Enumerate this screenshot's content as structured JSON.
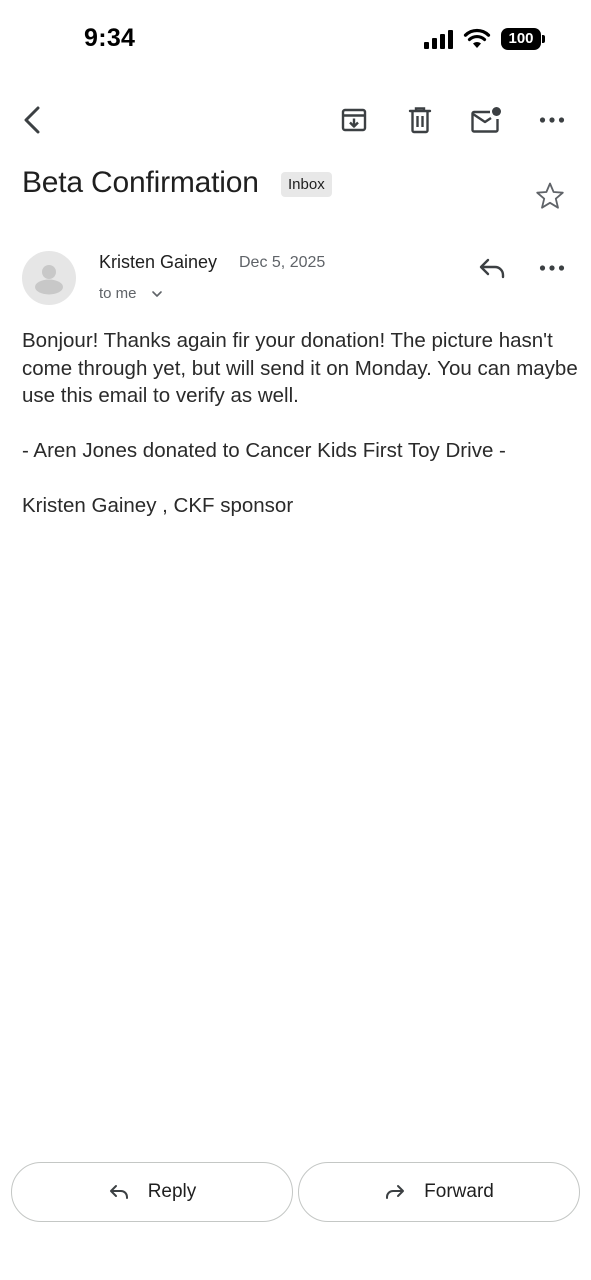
{
  "status_bar": {
    "time": "9:34",
    "battery": "100"
  },
  "email": {
    "subject": "Beta Confirmation",
    "label": "Inbox",
    "sender": {
      "name": "Kristen Gainey",
      "date": "Dec 5, 2025",
      "recipient": "to me"
    },
    "body": [
      "Bonjour! Thanks again fir your donation! The picture hasn't come through yet, but will send it on Monday. You can maybe use this email to verify as well.",
      "- Aren Jones donated to Cancer Kids First Toy Drive -",
      "Kristen Gainey , CKF sponsor"
    ]
  },
  "actions": {
    "reply": "Reply",
    "forward": "Forward"
  }
}
